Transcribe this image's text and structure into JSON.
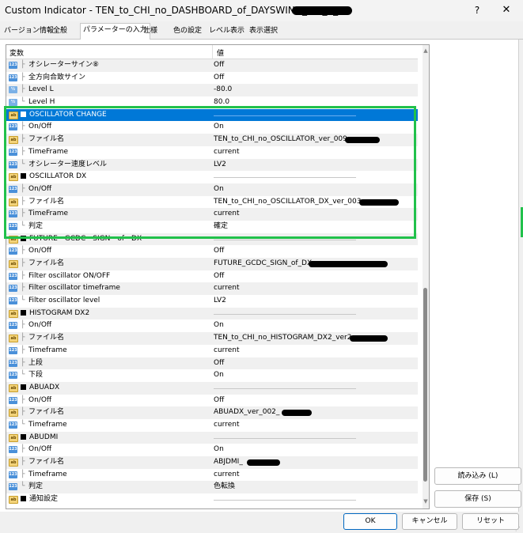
{
  "window": {
    "title": "Custom Indicator - TEN_to_CHI_no_DASHBOARD_of_DAYSWING_ver_2_",
    "help_glyph": "?",
    "close_glyph": "✕"
  },
  "tabs": [
    {
      "label": "バージョン情報"
    },
    {
      "label": "全般"
    },
    {
      "label": "パラメーターの入力"
    },
    {
      "label": "仕様"
    },
    {
      "label": "色の設定"
    },
    {
      "label": "レベル表示"
    },
    {
      "label": "表示選択"
    }
  ],
  "grid": {
    "col_variable": "変数",
    "col_value": "値",
    "rows": [
      {
        "icon": "num",
        "tree": "├",
        "name": "オシレーターサイン⑧",
        "value": "Off",
        "group": false
      },
      {
        "icon": "num",
        "tree": "├",
        "name": "全方向合致サイン",
        "value": "Off",
        "group": false
      },
      {
        "icon": "dbl",
        "tree": "├",
        "name": "Level L",
        "value": "-80.0",
        "group": false
      },
      {
        "icon": "dbl",
        "tree": "└",
        "name": "Level H",
        "value": "80.0",
        "group": false
      },
      {
        "icon": "str",
        "tree": "",
        "name": "OSCILLATOR CHANGE",
        "value": "",
        "group": true,
        "selected": true
      },
      {
        "icon": "num",
        "tree": "├",
        "name": "On/Off",
        "value": "On",
        "group": false
      },
      {
        "icon": "str",
        "tree": "├",
        "name": "ファイル名",
        "value": "TEN_to_CHI_no_OSCILLATOR_ver_009_",
        "group": false
      },
      {
        "icon": "num",
        "tree": "├",
        "name": "TimeFrame",
        "value": "current",
        "group": false
      },
      {
        "icon": "num",
        "tree": "└",
        "name": "オシレーター速度レベル",
        "value": "LV2",
        "group": false
      },
      {
        "icon": "str",
        "tree": "",
        "name": "OSCILLATOR DX",
        "value": "",
        "group": true
      },
      {
        "icon": "num",
        "tree": "├",
        "name": "On/Off",
        "value": "On",
        "group": false
      },
      {
        "icon": "str",
        "tree": "├",
        "name": "ファイル名",
        "value": "TEN_to_CHI_no_OSCILLATOR_DX_ver_003_",
        "group": false
      },
      {
        "icon": "num",
        "tree": "├",
        "name": "TimeFrame",
        "value": "current",
        "group": false
      },
      {
        "icon": "num",
        "tree": "└",
        "name": "判定",
        "value": "確定",
        "group": false
      },
      {
        "icon": "str",
        "tree": "",
        "name": "FUTURE　GCDC　SIGN　of　DX",
        "value": "",
        "group": true
      },
      {
        "icon": "num",
        "tree": "├",
        "name": "On/Off",
        "value": "Off",
        "group": false
      },
      {
        "icon": "str",
        "tree": "├",
        "name": "ファイル名",
        "value": "FUTURE_GCDC_SIGN_of_DX_",
        "group": false
      },
      {
        "icon": "num",
        "tree": "├",
        "name": "Filter oscillator ON/OFF",
        "value": "Off",
        "group": false
      },
      {
        "icon": "num",
        "tree": "├",
        "name": "Filter oscillator timeframe",
        "value": "current",
        "group": false
      },
      {
        "icon": "num",
        "tree": "└",
        "name": "Filter oscillator level",
        "value": "LV2",
        "group": false
      },
      {
        "icon": "str",
        "tree": "",
        "name": "HISTOGRAM DX2",
        "value": "",
        "group": true
      },
      {
        "icon": "num",
        "tree": "├",
        "name": "On/Off",
        "value": "On",
        "group": false
      },
      {
        "icon": "str",
        "tree": "├",
        "name": "ファイル名",
        "value": "TEN_to_CHI_no_HISTOGRAM_DX2_ver2_",
        "group": false
      },
      {
        "icon": "num",
        "tree": "├",
        "name": "Timeframe",
        "value": "current",
        "group": false
      },
      {
        "icon": "num",
        "tree": "├",
        "name": "上段",
        "value": "Off",
        "group": false
      },
      {
        "icon": "num",
        "tree": "└",
        "name": "下段",
        "value": "On",
        "group": false
      },
      {
        "icon": "str",
        "tree": "",
        "name": "ABUADX",
        "value": "",
        "group": true
      },
      {
        "icon": "num",
        "tree": "├",
        "name": "On/Off",
        "value": "Off",
        "group": false
      },
      {
        "icon": "str",
        "tree": "├",
        "name": "ファイル名",
        "value": "ABUADX_ver_002_",
        "group": false
      },
      {
        "icon": "num",
        "tree": "└",
        "name": "Timeframe",
        "value": "current",
        "group": false
      },
      {
        "icon": "str",
        "tree": "",
        "name": "ABUDMI",
        "value": "",
        "group": true
      },
      {
        "icon": "num",
        "tree": "├",
        "name": "On/Off",
        "value": "On",
        "group": false
      },
      {
        "icon": "str",
        "tree": "├",
        "name": "ファイル名",
        "value": "ABJDMI_",
        "group": false
      },
      {
        "icon": "num",
        "tree": "├",
        "name": "Timeframe",
        "value": "current",
        "group": false
      },
      {
        "icon": "num",
        "tree": "└",
        "name": "判定",
        "value": "色転換",
        "group": false
      },
      {
        "icon": "str",
        "tree": "",
        "name": "通知設定",
        "value": "",
        "group": true
      }
    ]
  },
  "buttons": {
    "load": "読み込み (L)",
    "save": "保存 (S)",
    "ok": "OK",
    "cancel": "キャンセル",
    "reset": "リセット"
  },
  "scrollbar": {
    "up_glyph": "▲",
    "down_glyph": "▼"
  },
  "colors": {
    "selection": "#0078d7",
    "highlight_box": "#21c14b"
  }
}
